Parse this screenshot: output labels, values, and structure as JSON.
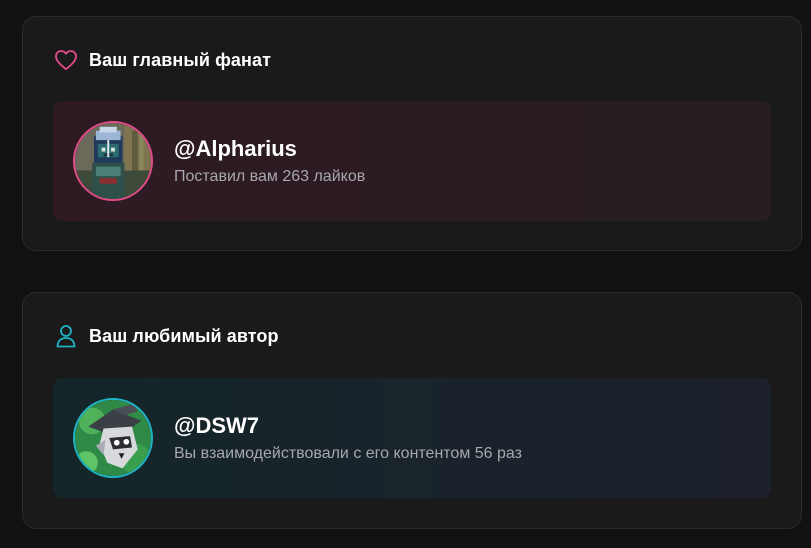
{
  "fan_card": {
    "title": "Ваш главный фанат",
    "icon": "heart-icon",
    "accent_color": "#e24b8a",
    "username": "@Alpharius",
    "description": "Поставил вам 263 лайков"
  },
  "author_card": {
    "title": "Ваш любимый автор",
    "icon": "user-icon",
    "accent_color": "#1fb3c6",
    "username": "@DSW7",
    "description": "Вы взаимодействовали с его контентом 56 раз"
  }
}
